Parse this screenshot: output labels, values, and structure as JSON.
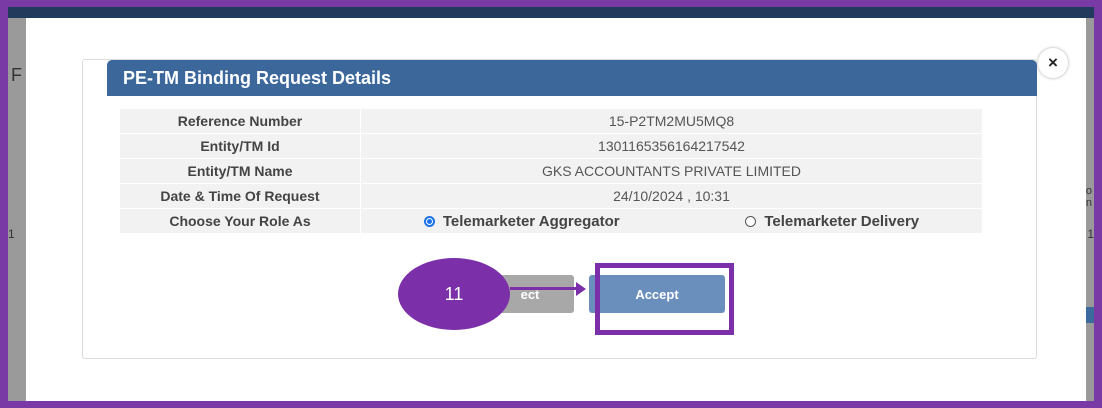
{
  "background": {
    "left_letter": "F",
    "left_number": "1",
    "right_text_line1": "o",
    "right_text_line2": "n",
    "right_number": "1"
  },
  "modal": {
    "close_icon": "×",
    "header_title": "PE-TM Binding Request Details",
    "rows": [
      {
        "label": "Reference Number",
        "value": "15-P2TM2MU5MQ8"
      },
      {
        "label": "Entity/TM Id",
        "value": "1301165356164217542"
      },
      {
        "label": "Entity/TM Name",
        "value": "GKS ACCOUNTANTS PRIVATE LIMITED"
      },
      {
        "label": "Date & Time Of Request",
        "value": "24/10/2024 , 10:31"
      }
    ],
    "role_label": "Choose Your Role As",
    "role_options": [
      {
        "label": "Telemarketer Aggregator",
        "selected": true
      },
      {
        "label": "Telemarketer Delivery",
        "selected": false
      }
    ],
    "reject_label": "ect",
    "accept_label": "Accept"
  },
  "annotation": {
    "step_number": "11",
    "color": "#7b2fa8"
  },
  "colors": {
    "header": "#3b679b",
    "accept": "#6a8fbd",
    "reject": "#a8a8a8",
    "frame": "#7a3aa6"
  }
}
